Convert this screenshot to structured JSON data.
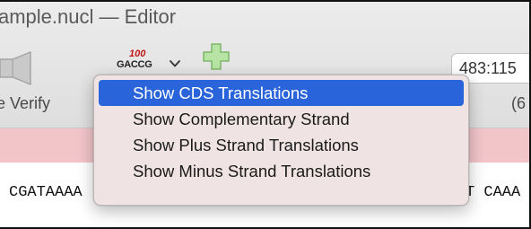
{
  "window": {
    "title": "ample.nucl — Editor"
  },
  "toolbar": {
    "speaker_icon": "speaker-icon",
    "gaccg_icon": {
      "number": "100",
      "sequence": "GACCG"
    },
    "add_icon": "plus-icon",
    "position_value": "483:115",
    "verify_label": "e Verify",
    "count_label": "(6"
  },
  "menu": {
    "items": [
      {
        "label": "Show CDS Translations",
        "selected": true
      },
      {
        "label": "Show Complementary Strand",
        "selected": false
      },
      {
        "label": "Show Plus Strand Translations",
        "selected": false
      },
      {
        "label": "Show Minus Strand Translations",
        "selected": false
      }
    ]
  },
  "sequence": {
    "left": "CGATAAAA",
    "right": "T CAAA"
  },
  "colors": {
    "accent": "#2a64da",
    "menu_bg": "#f0e3e4",
    "pink_band": "#f2c5c9",
    "gaccg_number": "#c01818",
    "plus_green": "#8ed07a"
  }
}
